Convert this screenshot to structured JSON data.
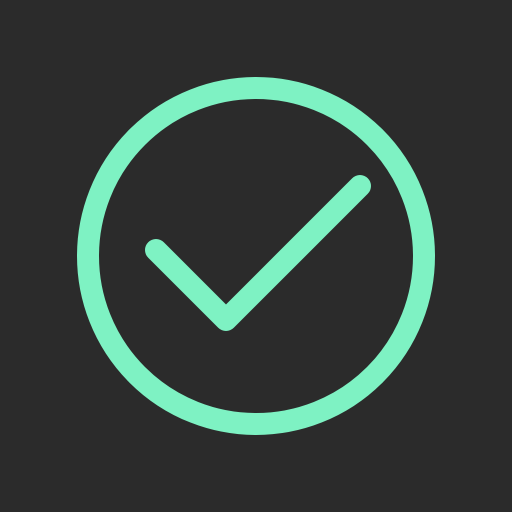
{
  "icon": {
    "name": "check-circle-icon",
    "background_color": "#2b2b2b",
    "stroke_color": "#7ef2c3"
  }
}
